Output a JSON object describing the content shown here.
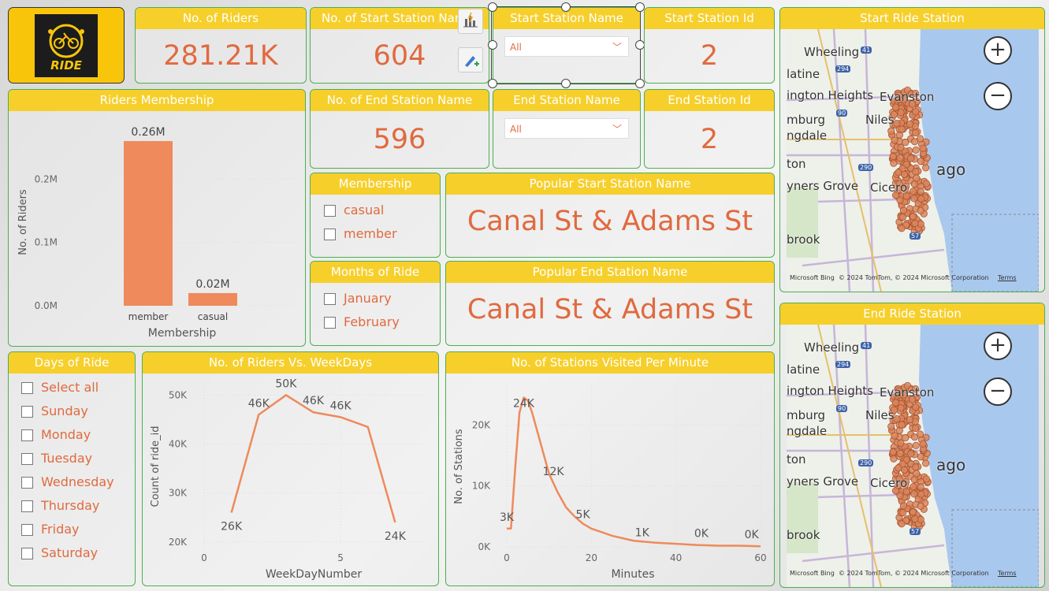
{
  "kpi": {
    "riders": {
      "title": "No. of Riders",
      "value": "281.21K"
    },
    "start_station_count": {
      "title": "No. of Start Station Name",
      "value": "604"
    },
    "start_station_name": {
      "title": "Start Station Name",
      "selected": "All"
    },
    "start_station_id": {
      "title": "Start Station Id",
      "value": "2"
    },
    "end_station_count": {
      "title": "No. of End Station Name",
      "value": "596"
    },
    "end_station_name": {
      "title": "End Station Name",
      "selected": "All"
    },
    "end_station_id": {
      "title": "End Station Id",
      "value": "2"
    },
    "popular_start": {
      "title": "Popular Start Station Name",
      "value": "Canal St & Adams St"
    },
    "popular_end": {
      "title": "Popular End Station Name",
      "value": "Canal St & Adams St"
    }
  },
  "logo": {
    "text": "RIDE"
  },
  "membership_slicer": {
    "title": "Membership",
    "items": [
      "casual",
      "member"
    ]
  },
  "months_slicer": {
    "title": "Months of Ride",
    "items": [
      "January",
      "February"
    ]
  },
  "days_slicer": {
    "title": "Days of Ride",
    "items": [
      "Select all",
      "Sunday",
      "Monday",
      "Tuesday",
      "Wednesday",
      "Thursday",
      "Friday",
      "Saturday"
    ]
  },
  "maps": {
    "start": {
      "title": "Start Ride Station"
    },
    "end": {
      "title": "End Ride Station"
    },
    "cities": [
      "Wheeling",
      "latine",
      "ington Heights",
      "Evanston",
      "mburg",
      "Niles",
      "ngdale",
      "ton",
      "ago",
      "yners Grove",
      "Cicero",
      "brook"
    ],
    "highway_labels": [
      "41",
      "294",
      "90",
      "290",
      "57"
    ],
    "attribution": "© 2024 TomTom, © 2024 Microsoft Corporation",
    "terms": "Terms",
    "bing_label": "Microsoft Bing",
    "zoom_in": "+",
    "zoom_out": "−"
  },
  "colors": {
    "accent": "#f6cf2b",
    "value": "#e06a3f",
    "bar": "#ee8a5c",
    "border": "#4caf50"
  },
  "chart_data": [
    {
      "type": "bar",
      "title": "Riders Membership",
      "categories": [
        "member",
        "casual"
      ],
      "values": [
        0.26,
        0.02
      ],
      "value_labels": [
        "0.26M",
        "0.02M"
      ],
      "xlabel": "Membership",
      "ylabel": "No. of Riders",
      "yticks": [
        "0.0M",
        "0.1M",
        "0.2M"
      ],
      "ylim": [
        0,
        0.27
      ]
    },
    {
      "type": "line",
      "title": "No. of Riders Vs. WeekDays",
      "x": [
        1,
        2,
        3,
        4,
        5,
        6,
        7
      ],
      "values": [
        26,
        46,
        50,
        46.5,
        45.5,
        43.5,
        24
      ],
      "point_labels": [
        "26K",
        "46K",
        "50K",
        "46K",
        "46K",
        "",
        "24K"
      ],
      "xlabel": "WeekDayNumber",
      "ylabel": "Count of ride_id",
      "xticks": [
        "0",
        "5"
      ],
      "yticks": [
        "20K",
        "30K",
        "40K",
        "50K"
      ],
      "xlim": [
        0,
        8
      ],
      "ylim": [
        19,
        52
      ]
    },
    {
      "type": "line",
      "title": "No. of Stations Visited Per Minute",
      "x": [
        0,
        1,
        2,
        3,
        4,
        5,
        6,
        8,
        10,
        12,
        14,
        16,
        18,
        20,
        25,
        30,
        35,
        40,
        45,
        50,
        55,
        60
      ],
      "values": [
        3,
        3,
        13,
        22,
        24.5,
        24,
        22,
        17,
        12,
        9,
        6.5,
        5,
        3.8,
        3,
        1.8,
        1,
        0.7,
        0.5,
        0.3,
        0.2,
        0.2,
        0.1
      ],
      "point_labels": [
        "3K",
        "24K",
        "12K",
        "5K",
        "1K",
        "0K",
        "0K"
      ],
      "xlabel": "Minutes",
      "ylabel": "No. of Stations",
      "xticks": [
        "0",
        "20",
        "40",
        "60"
      ],
      "yticks": [
        "0K",
        "10K",
        "20K"
      ],
      "xlim": [
        0,
        60
      ],
      "ylim": [
        0,
        26.5
      ]
    }
  ]
}
